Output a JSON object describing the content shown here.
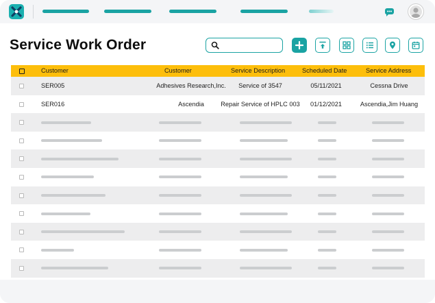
{
  "page": {
    "title": "Service Work Order"
  },
  "colors": {
    "accent": "#1aa3a3",
    "header": "#fdbe0b"
  },
  "toolbar": {
    "search_placeholder": "",
    "buttons": [
      "add-icon",
      "upload-icon",
      "grid-view-icon",
      "list-view-icon",
      "location-pin-icon",
      "calendar-icon"
    ]
  },
  "table": {
    "columns": [
      "Customer",
      "Customer",
      "Service Description",
      "Scheduled Date",
      "Service Address"
    ],
    "rows": [
      {
        "id": "SER005",
        "customer": "Adhesives Research,Inc.",
        "description": "Service of 3547",
        "date": "05/11/2021",
        "address": "Cessna Drive"
      },
      {
        "id": "SER016",
        "customer": "Ascendia",
        "description": "Repair Service of HPLC 003",
        "date": "01/12/2021",
        "address": "Ascendia,Jim Huang"
      }
    ],
    "placeholder_rows": 9
  }
}
